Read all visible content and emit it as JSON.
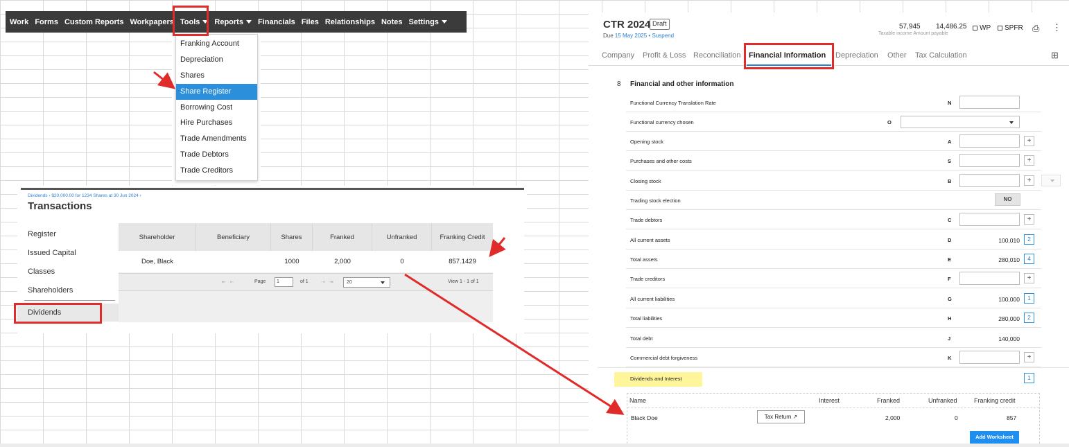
{
  "topnav": {
    "items": [
      "Work",
      "Forms",
      "Custom Reports",
      "Workpapers",
      "Tools",
      "Reports",
      "Financials",
      "Files",
      "Relationships",
      "Notes",
      "Settings"
    ]
  },
  "tools_menu": {
    "items": [
      "Franking Account",
      "Depreciation",
      "Shares",
      "Share Register",
      "Borrowing Cost",
      "Hire Purchases",
      "Trade Amendments",
      "Trade Debtors",
      "Trade Creditors"
    ],
    "selected": "Share Register"
  },
  "transactions": {
    "breadcrumb": "Dividends › $20,000.00 for 1234 Shares at 30 Jun 2024 ›",
    "title": "Transactions",
    "sidebar": [
      "Register",
      "Issued Capital",
      "Classes",
      "Shareholders",
      "Dividends"
    ],
    "columns": [
      "Shareholder",
      "Beneficiary",
      "Shares",
      "Franked",
      "Unfranked",
      "Franking Credit"
    ],
    "rows": [
      [
        "Doe, Black",
        "",
        "1000",
        "2,000",
        "0",
        "857.1429"
      ]
    ],
    "pager": {
      "page_label": "Page",
      "page_value": "1",
      "of_label": "of 1",
      "page_size": "20",
      "view_text": "View 1 - 1 of 1"
    }
  },
  "ctr": {
    "title": "CTR 2024",
    "status": "Draft",
    "due_prefix": "Due",
    "due_date": "15 May 2025",
    "due_sep": "•",
    "suspend": "Suspend",
    "taxable_income": "57,945",
    "amount_payable": "14,486.25",
    "amounts_label": "Taxable income Amount payable",
    "check_wp": "WP",
    "check_spfr": "SPFR",
    "tabs": [
      "Company",
      "Profit & Loss",
      "Reconciliation",
      "Financial Information",
      "Depreciation",
      "Other",
      "Tax Calculation"
    ],
    "active_tab": "Financial Information",
    "section_number": "8",
    "section_title": "Financial and other information",
    "rows": [
      {
        "label": "Functional Currency Translation Rate",
        "code": "N",
        "value": ""
      },
      {
        "label": "Functional currency chosen",
        "code": "O",
        "value": ""
      },
      {
        "label": "Opening stock",
        "code": "A",
        "value": ""
      },
      {
        "label": "Purchases and other costs",
        "code": "S",
        "value": ""
      },
      {
        "label": "Closing stock",
        "code": "B",
        "value": ""
      },
      {
        "label": "Trading stock election",
        "code": "",
        "value": "NO"
      },
      {
        "label": "Trade debtors",
        "code": "C",
        "value": ""
      },
      {
        "label": "All current assets",
        "code": "D",
        "value": "100,010",
        "badge": "2"
      },
      {
        "label": "Total assets",
        "code": "E",
        "value": "280,010",
        "badge": "4"
      },
      {
        "label": "Trade creditors",
        "code": "F",
        "value": ""
      },
      {
        "label": "All current liabilities",
        "code": "G",
        "value": "100,000",
        "badge": "1"
      },
      {
        "label": "Total liabilities",
        "code": "H",
        "value": "280,000",
        "badge": "2"
      },
      {
        "label": "Total debt",
        "code": "J",
        "value": "140,000"
      },
      {
        "label": "Commercial debt forgiveness",
        "code": "K",
        "value": ""
      }
    ],
    "dividends": {
      "title": "Dividends and Interest",
      "badge": "1",
      "columns": [
        "Name",
        "Interest",
        "Franked",
        "Unfranked",
        "Franking credit"
      ],
      "row": {
        "name": "Black Doe",
        "button": "Tax Return",
        "interest": "",
        "franked": "2,000",
        "unfranked": "0",
        "franking_credit": "857"
      },
      "add_button": "Add Worksheet"
    }
  },
  "colors": {
    "accent": "#2b8fdc",
    "highlight_box": "#e02b2b",
    "nav_bg": "#3b3b3b",
    "yellow_highlight": "#fff59a"
  }
}
